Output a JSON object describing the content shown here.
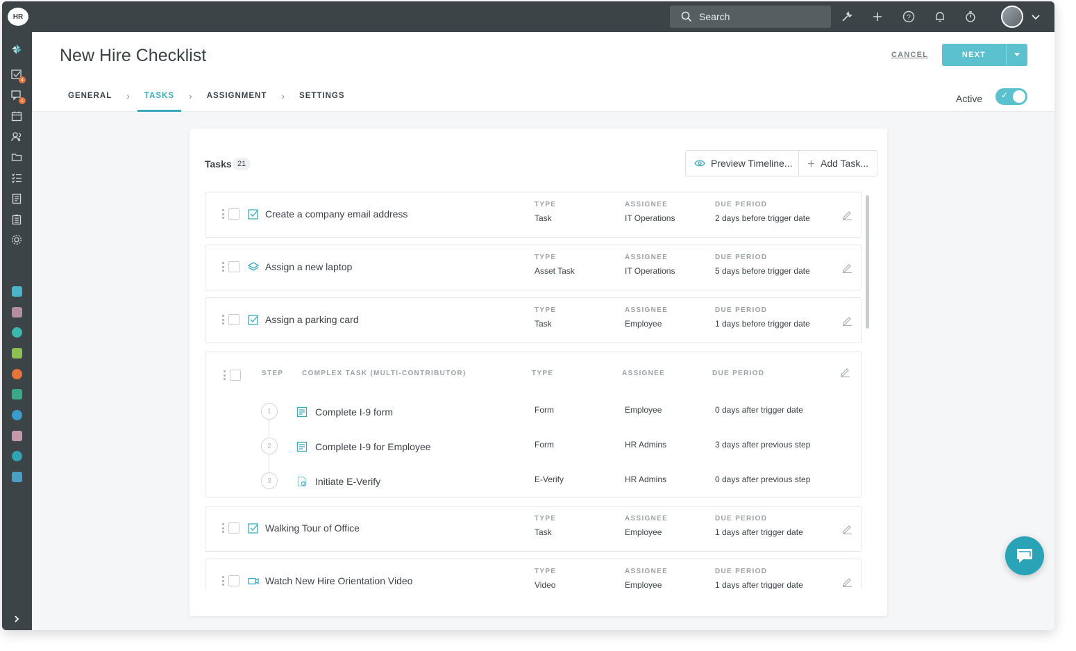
{
  "app": {
    "logo_text": "HR",
    "accent": "#3aa9b8"
  },
  "topbar": {
    "search_label": "Search",
    "icons": [
      "wrench-icon",
      "plus-icon",
      "help-icon",
      "bell-icon",
      "timer-icon",
      "avatar",
      "chevron-down-icon"
    ]
  },
  "sidebar": {
    "badges": {
      "tasks": "4",
      "messages": "1"
    },
    "expand_icon": "chevron-right-icon"
  },
  "header": {
    "title": "New Hire Checklist",
    "cancel_label": "CANCEL",
    "next_label": "NEXT",
    "steps": [
      "GENERAL",
      "TASKS",
      "ASSIGNMENT",
      "SETTINGS"
    ],
    "active_step": "TASKS",
    "active_label": "Active",
    "active_on": true
  },
  "tasks": {
    "title": "Tasks",
    "count": "21",
    "preview_label": "Preview Timeline...",
    "add_label": "Add Task...",
    "col_type": "TYPE",
    "col_assignee": "ASSIGNEE",
    "col_due": "DUE PERIOD",
    "rows": [
      {
        "name": "Create a company email address",
        "icon": "task-check-icon",
        "type": "Task",
        "assignee": "IT Operations",
        "due": "2 days before trigger date"
      },
      {
        "name": "Assign a new laptop",
        "icon": "layers-icon",
        "type": "Asset Task",
        "assignee": "IT Operations",
        "due": "5 days before trigger date"
      },
      {
        "name": "Assign a parking card",
        "icon": "task-check-icon",
        "type": "Task",
        "assignee": "Employee",
        "due": "1 days before trigger date"
      },
      {
        "name": "Walking Tour of Office",
        "icon": "task-check-icon",
        "type": "Task",
        "assignee": "Employee",
        "due": "1 days after trigger date"
      },
      {
        "name": "Watch New Hire Orientation Video",
        "icon": "video-icon",
        "type": "Video",
        "assignee": "Employee",
        "due": "1 days after trigger date"
      }
    ],
    "complex": {
      "col_step": "STEP",
      "col_task": "COMPLEX TASK (MULTI-CONTRIBUTOR)",
      "col_type": "TYPE",
      "col_assignee": "ASSIGNEE",
      "col_due": "DUE PERIOD",
      "steps": [
        {
          "num": "1",
          "name": "Complete I-9 form",
          "icon": "form-icon",
          "type": "Form",
          "assignee": "Employee",
          "due": "0 days after trigger date"
        },
        {
          "num": "2",
          "name": "Complete I-9 for Employee",
          "icon": "form-icon",
          "type": "Form",
          "assignee": "HR Admins",
          "due": "3 days after previous step"
        },
        {
          "num": "3",
          "name": "Initiate E-Verify",
          "icon": "everify-icon",
          "type": "E-Verify",
          "assignee": "HR Admins",
          "due": "0 days after previous step"
        }
      ]
    }
  }
}
